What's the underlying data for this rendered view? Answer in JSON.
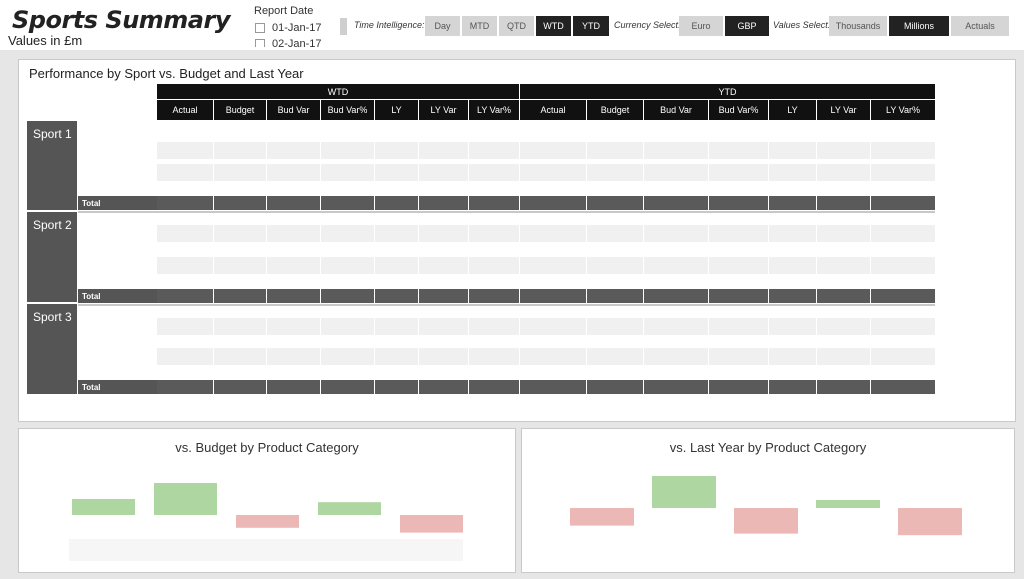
{
  "header": {
    "title": "Sports Summary",
    "subtitle": "Values in £m",
    "report_date": {
      "label": "Report Date",
      "options": [
        "01-Jan-17",
        "02-Jan-17"
      ]
    },
    "time_intelligence": {
      "label": "Time Intelligence:",
      "options": [
        "Day",
        "MTD",
        "QTD",
        "WTD",
        "YTD"
      ],
      "selected": [
        "WTD",
        "YTD"
      ]
    },
    "currency": {
      "label": "Currency Select:",
      "options": [
        "Euro",
        "GBP"
      ],
      "selected": "GBP"
    },
    "values": {
      "label": "Values Select:",
      "options": [
        "Thousands",
        "Millions",
        "Actuals"
      ],
      "selected": "Millions"
    }
  },
  "main": {
    "title": "Performance by Sport vs. Budget and Last Year",
    "bands": [
      "WTD",
      "YTD"
    ],
    "columns": [
      "Actual",
      "Budget",
      "Bud Var",
      "Bud Var%",
      "LY",
      "LY Var",
      "LY Var%"
    ],
    "sports": [
      {
        "name": "Sport 1",
        "total_label": "Total"
      },
      {
        "name": "Sport 2",
        "total_label": "Total"
      },
      {
        "name": "Sport 3",
        "total_label": "Total"
      }
    ]
  },
  "charts": {
    "budget_title": "vs. Budget by Product Category",
    "ly_title": "vs. Last Year by Product Category"
  },
  "chart_data": [
    {
      "type": "bar",
      "title": "vs. Budget by Product Category",
      "values": [
        1,
        2,
        -0.8,
        0.8,
        -1.1
      ],
      "colors": {
        "positive": "#aed6a0",
        "negative": "#ebb8b6"
      }
    },
    {
      "type": "bar",
      "title": "vs. Last Year by Product Category",
      "values": [
        -1.1,
        2,
        -1.6,
        0.5,
        -1.7
      ],
      "colors": {
        "positive": "#aed6a0",
        "negative": "#ebb8b6"
      }
    }
  ]
}
